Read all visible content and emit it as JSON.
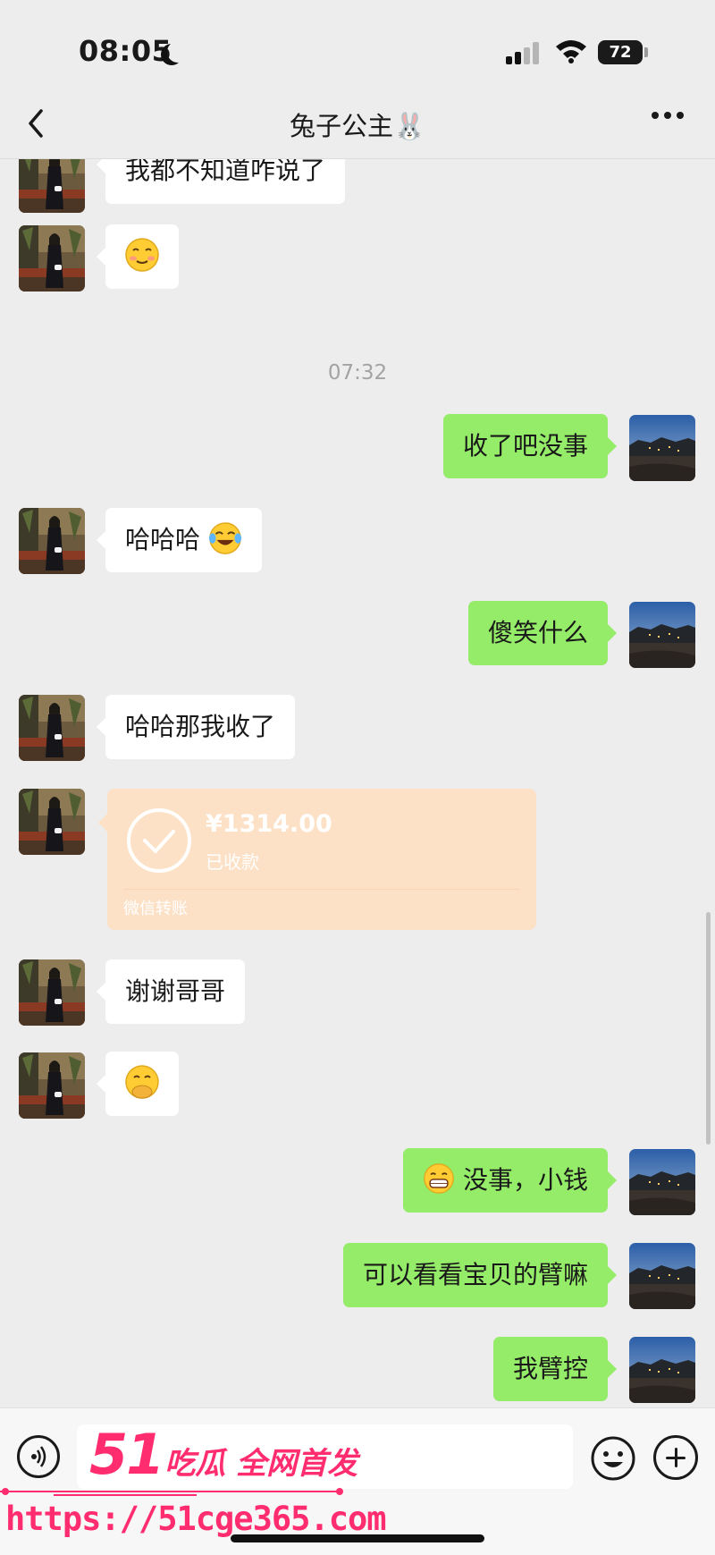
{
  "status_bar": {
    "time": "08:05",
    "battery": "72"
  },
  "nav": {
    "title": "兔子公主🐰"
  },
  "messages": [
    {
      "from": "contact",
      "text": "我都不知道咋说了"
    },
    {
      "from": "contact",
      "emoji": "smiling-face-icon"
    },
    {
      "timestamp": "07:32"
    },
    {
      "from": "me",
      "text": "收了吧没事"
    },
    {
      "from": "contact",
      "text": "哈哈哈"
    },
    {
      "from": "me",
      "text": "傻笑什么"
    },
    {
      "from": "contact",
      "text": "哈哈那我收了"
    },
    {
      "from": "contact",
      "transfer": {
        "amount": "¥1314.00",
        "status": "已收款",
        "label": "微信转账"
      }
    },
    {
      "from": "contact",
      "text": "谢谢哥哥"
    },
    {
      "from": "contact",
      "emoji": "shy-face-icon"
    },
    {
      "from": "me",
      "text": "没事，小钱"
    },
    {
      "from": "me",
      "text": "可以看看宝贝的臂嘛"
    },
    {
      "from": "me",
      "text": "我臂控"
    }
  ],
  "watermark": {
    "brand_num": "51",
    "brand_text": "吃瓜 全网首发",
    "url": "https://51cge365.com"
  },
  "colors": {
    "background": "#ededed",
    "outgoing_bubble": "#95ec69",
    "incoming_bubble": "#ffffff",
    "transfer_card": "#fde1c6",
    "watermark": "#ff2d6f"
  }
}
